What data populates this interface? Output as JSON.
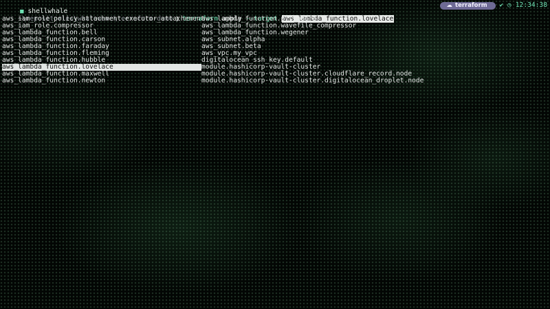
{
  "window": {
    "title": "shellwhale",
    "icon": "terminal-icon"
  },
  "status": {
    "context_badge": "terraform",
    "badge_icon": "cloud-icon",
    "ok_icon": "check-icon",
    "time": "12:34:38"
  },
  "prompt": {
    "cwd": "~\\repositories\\whalewave\\terraform-demo",
    "chevron": "❯",
    "command": "terraform",
    "subcommand": "apply",
    "flag": "--target",
    "flag_value": "aws_lambda_function.lovelace"
  },
  "completions": {
    "left": [
      "aws_iam_role_policy_attachment.executor_attachement",
      "aws_iam_role.compressor",
      "aws_lambda_function.bell",
      "aws_lambda_function.carson",
      "aws_lambda_function.faraday",
      "aws_lambda_function.fleming",
      "aws_lambda_function.hubble",
      "aws_lambda_function.lovelace",
      "aws_lambda_function.maxwell",
      "aws_lambda_function.newton"
    ],
    "right": [
      "aws_lambda_function.pythagore",
      "aws_lambda_function.wavefile_compressor",
      "aws_lambda_function.wegener",
      "aws_subnet.alpha",
      "aws_subnet.beta",
      "aws_vpc.my_vpc",
      "digitalocean_ssh_key.default",
      "module.hashicorp-vault-cluster",
      "module.hashicorp-vault-cluster.cloudflare_record.node",
      "module.hashicorp-vault-cluster.digitalocean_droplet.node"
    ],
    "selected": "aws_lambda_function.lovelace"
  },
  "colors": {
    "accent": "#6fe3b4",
    "badge_bg": "#6e6a95",
    "background": "#030604"
  }
}
